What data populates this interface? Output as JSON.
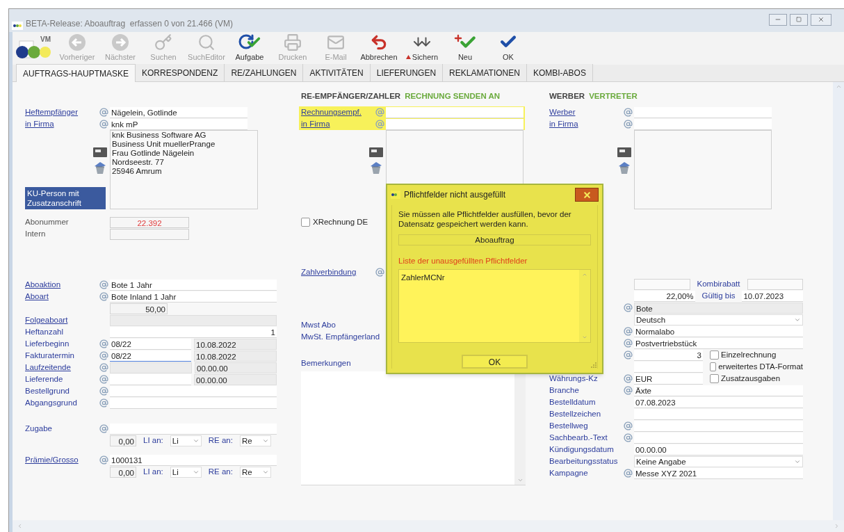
{
  "window": {
    "title": "BETA-Release: Aboauftrag  erfassen 0 von 21.466 (VM)",
    "logo_text": "VM"
  },
  "toolbar": [
    {
      "kind": "previous",
      "label": "Vorheriger",
      "disabled": true
    },
    {
      "kind": "next",
      "label": "Nächster",
      "disabled": true
    },
    {
      "kind": "search",
      "label": "Suchen",
      "disabled": true
    },
    {
      "kind": "editor",
      "label": "SuchEditor",
      "disabled": true
    },
    {
      "kind": "task",
      "label": "Aufgabe",
      "disabled": false
    },
    {
      "kind": "print",
      "label": "Drucken",
      "disabled": true
    },
    {
      "kind": "email",
      "label": "E-Mail",
      "disabled": true
    },
    {
      "kind": "cancel",
      "label": "Abbrechen",
      "disabled": false
    },
    {
      "kind": "save",
      "label": "Sichern",
      "disabled": false
    },
    {
      "kind": "new",
      "label": "Neu",
      "disabled": false
    },
    {
      "kind": "ok",
      "label": "OK",
      "disabled": false
    }
  ],
  "tabs": [
    {
      "label": "AUFTRAGS-HAUPTMASKE",
      "selected": true
    },
    {
      "label": "KORRESPONDENZ",
      "selected": false
    },
    {
      "label": "RE/ZAHLUNGEN",
      "selected": false
    },
    {
      "label": "AKTIVITÄTEN",
      "selected": false
    },
    {
      "label": "LIEFERUNGEN",
      "selected": false
    },
    {
      "label": "REKLAMATIONEN",
      "selected": false
    },
    {
      "label": "KOMBI-ABOS",
      "selected": false
    }
  ],
  "columns": [
    {
      "sections": [
        {
          "kind": "party",
          "rows": [
            {
              "label": "Heftempfänger",
              "kind": "link",
              "at": true,
              "highlighted": false,
              "fields": [
                {
                  "kind": "text",
                  "value": "Nägelein, Gotlinde"
                }
              ]
            },
            {
              "label": "in Firma",
              "kind": "link",
              "at": true,
              "highlighted": false,
              "fields": [
                {
                  "kind": "text",
                  "value": "knk mP"
                }
              ]
            }
          ],
          "address": [
            "knk Business Software AG",
            "Business Unit muellerPrange",
            "Frau Gotlinde Nägelein",
            "Nordseestr. 77",
            "25946 Amrum"
          ],
          "button": "KU-Person mit Zusatzanschrift"
        },
        {
          "kind": "rows",
          "rows": [
            {
              "label": "Abonummer",
              "kind": "muted",
              "at": false,
              "fields": [
                {
                  "kind": "id",
                  "value": "22.392"
                }
              ]
            },
            {
              "label": "Intern",
              "kind": "muted",
              "at": false,
              "fields": [
                {
                  "kind": "id"
                }
              ]
            }
          ]
        },
        {
          "kind": "rows",
          "rows": [
            {
              "label": "Aboaktion",
              "kind": "link",
              "at": true,
              "fields": [
                {
                  "kind": "text",
                  "value": "Bote 1 Jahr"
                }
              ]
            },
            {
              "label": "Aboart",
              "kind": "link",
              "at": true,
              "fields": [
                {
                  "kind": "text",
                  "value": "Bote Inland 1 Jahr"
                }
              ]
            },
            {
              "at": false,
              "fields": [
                {
                  "kind": "price",
                  "value": "50,00"
                }
              ]
            },
            {
              "label": "Folgeaboart",
              "kind": "link",
              "at": false,
              "fields": [
                {
                  "kind": "readonly"
                }
              ]
            },
            {
              "label": "Heftanzahl",
              "kind": "plain",
              "at": false,
              "fields": [
                {
                  "kind": "number",
                  "value": "1"
                }
              ]
            },
            {
              "label": "Lieferbeginn",
              "kind": "plain",
              "at": true,
              "fields": [
                {
                  "kind": "text",
                  "value": "08/22"
                },
                {
                  "kind": "readonly",
                  "value": "10.08.2022"
                }
              ]
            },
            {
              "label": "Fakturatermin",
              "kind": "plain",
              "at": true,
              "fields": [
                {
                  "kind": "text",
                  "value": "08/22",
                  "focused": true
                },
                {
                  "kind": "readonly",
                  "value": "10.08.2022"
                }
              ]
            },
            {
              "label": "Laufzeitende",
              "kind": "link",
              "at": true,
              "fields": [
                {
                  "kind": "readonly"
                },
                {
                  "kind": "readonly",
                  "value": "00.00.00"
                }
              ]
            },
            {
              "label": "Lieferende",
              "kind": "plain",
              "at": true,
              "fields": [
                {
                  "kind": "text"
                },
                {
                  "kind": "readonly",
                  "value": "00.00.00"
                }
              ]
            },
            {
              "label": "Bestellgrund",
              "kind": "plain",
              "at": true,
              "fields": [
                {
                  "kind": "text"
                }
              ]
            },
            {
              "label": "Abgangsgrund",
              "kind": "plain",
              "at": true,
              "fields": [
                {
                  "kind": "text"
                }
              ]
            }
          ]
        },
        {
          "kind": "rows",
          "rows": [
            {
              "label": "Zugabe",
              "kind": "plain",
              "at": true,
              "fields": [
                {
                  "kind": "text"
                }
              ]
            },
            {
              "at": false,
              "fields": [
                {
                  "kind": "amount",
                  "value": "0,00"
                },
                {
                  "kind": "caption",
                  "value": "LI an:"
                },
                {
                  "kind": "select",
                  "value": "Li"
                },
                {
                  "kind": "caption",
                  "value": "RE an:"
                },
                {
                  "kind": "select",
                  "value": "Re"
                }
              ]
            }
          ]
        },
        {
          "kind": "rows",
          "rows": [
            {
              "label": "Prämie/Grosso",
              "kind": "link",
              "at": true,
              "fields": [
                {
                  "kind": "text",
                  "value": "1000131"
                }
              ]
            },
            {
              "at": false,
              "fields": [
                {
                  "kind": "amount",
                  "value": "0,00"
                },
                {
                  "kind": "caption",
                  "value": "LI an:"
                },
                {
                  "kind": "select",
                  "value": "Li"
                },
                {
                  "kind": "caption",
                  "value": "RE an:"
                },
                {
                  "kind": "select",
                  "value": "Re"
                }
              ]
            }
          ]
        }
      ]
    },
    {
      "header": {
        "title": "RE-EMPFÄNGER/ZAHLER",
        "subtitle": "RECHNUNG SENDEN AN"
      },
      "sections": [
        {
          "kind": "party",
          "rows": [
            {
              "label": "Rechnungsempf.",
              "kind": "link",
              "at": true,
              "highlighted": true,
              "fields": [
                {
                  "kind": "text"
                }
              ]
            },
            {
              "label": "in Firma",
              "kind": "link",
              "at": true,
              "highlighted": true,
              "fields": [
                {
                  "kind": "text"
                }
              ]
            }
          ]
        },
        {
          "kind": "option",
          "checkbox": {
            "label": "XRechnung DE",
            "checked": false
          }
        },
        {
          "kind": "rows",
          "rows": [
            {
              "label": "Zahlverbindung",
              "kind": "link",
              "at": true
            }
          ]
        },
        {
          "kind": "rows",
          "rows": [
            {
              "label": "Mwst Abo",
              "kind": "plain",
              "at": false
            },
            {
              "label": "MwSt. Empfängerland",
              "kind": "plain",
              "at": false
            }
          ]
        },
        {
          "kind": "notes",
          "label": "Bemerkungen"
        }
      ]
    },
    {
      "header": {
        "title": "WERBER",
        "subtitle": "VERTRETER"
      },
      "sections": [
        {
          "kind": "party",
          "rows": [
            {
              "label": "Werber",
              "kind": "link",
              "at": true,
              "highlighted": false,
              "fields": [
                {
                  "kind": "text"
                }
              ]
            },
            {
              "label": "in Firma",
              "kind": "link",
              "at": true,
              "highlighted": false,
              "fields": [
                {
                  "kind": "text"
                }
              ]
            }
          ]
        },
        {
          "kind": "rows",
          "rows": [
            {
              "at": false,
              "fields": [
                {
                  "kind": "frame"
                },
                {
                  "kind": "caption",
                  "value": "Kombirabatt"
                },
                {
                  "kind": "frame"
                }
              ]
            },
            {
              "at": false,
              "fields": [
                {
                  "kind": "number",
                  "value": "22,00%"
                },
                {
                  "kind": "caption",
                  "value": "Gültig bis"
                },
                {
                  "kind": "text",
                  "value": "10.07.2023"
                }
              ]
            },
            {
              "at": true,
              "fields": [
                {
                  "kind": "readonly",
                  "value": "Bote"
                }
              ]
            },
            {
              "at": false,
              "fields": [
                {
                  "kind": "select",
                  "value": "Deutsch"
                }
              ]
            },
            {
              "at": true,
              "fields": [
                {
                  "kind": "text",
                  "value": "Normalabo"
                }
              ]
            },
            {
              "at": true,
              "fields": [
                {
                  "kind": "text",
                  "value": "Postvertriebstück"
                }
              ]
            },
            {
              "at": true,
              "fields": [
                {
                  "kind": "number",
                  "value": "3"
                },
                {
                  "kind": "checkbox",
                  "value": "Einzelrechnung",
                  "checked": false
                }
              ]
            },
            {
              "at": false,
              "fields": [
                {
                  "kind": "text"
                },
                {
                  "kind": "checkbox",
                  "value": "erweitertes DTA-Format",
                  "checked": false
                }
              ]
            },
            {
              "label": "Währungs-Kz",
              "kind": "plain",
              "at": true,
              "fields": [
                {
                  "kind": "text",
                  "value": "EUR"
                },
                {
                  "kind": "checkbox",
                  "value": "Zusatzausgaben",
                  "checked": false
                }
              ]
            },
            {
              "label": "Branche",
              "kind": "plain",
              "at": true,
              "fields": [
                {
                  "kind": "text",
                  "value": "Äxte"
                }
              ]
            },
            {
              "label": "Bestelldatum",
              "kind": "plain",
              "at": false,
              "fields": [
                {
                  "kind": "text",
                  "value": "07.08.2023"
                }
              ]
            },
            {
              "label": "Bestellzeichen",
              "kind": "plain",
              "at": false,
              "fields": [
                {
                  "kind": "text"
                }
              ]
            },
            {
              "label": "Bestellweg",
              "kind": "plain",
              "at": true,
              "fields": [
                {
                  "kind": "text"
                }
              ]
            },
            {
              "label": "Sachbearb.-Text",
              "kind": "plain",
              "at": true,
              "fields": [
                {
                  "kind": "text"
                }
              ]
            },
            {
              "label": "Kündigungsdatum",
              "kind": "plain",
              "at": false,
              "fields": [
                {
                  "kind": "text",
                  "value": "00.00.00"
                }
              ]
            },
            {
              "label": "Bearbeitungsstatus",
              "kind": "plain",
              "at": false,
              "fields": [
                {
                  "kind": "select",
                  "value": "Keine Angabe"
                }
              ]
            },
            {
              "label": "Kampagne",
              "kind": "plain",
              "at": true,
              "fields": [
                {
                  "kind": "text",
                  "value": "Messe XYZ 2021"
                }
              ]
            }
          ]
        }
      ]
    }
  ],
  "dialog": {
    "title": "Pflichtfelder nicht ausgefüllt",
    "message": "Sie müssen alle Pflichtfelder ausfüllen, bevor der Datensatz gespeichert werden kann.",
    "record": "Aboauftrag",
    "list_label": "Liste der unausgefüllten Pflichtfelder",
    "missing_fields": [
      "ZahlerMCNr"
    ],
    "button": "OK"
  }
}
